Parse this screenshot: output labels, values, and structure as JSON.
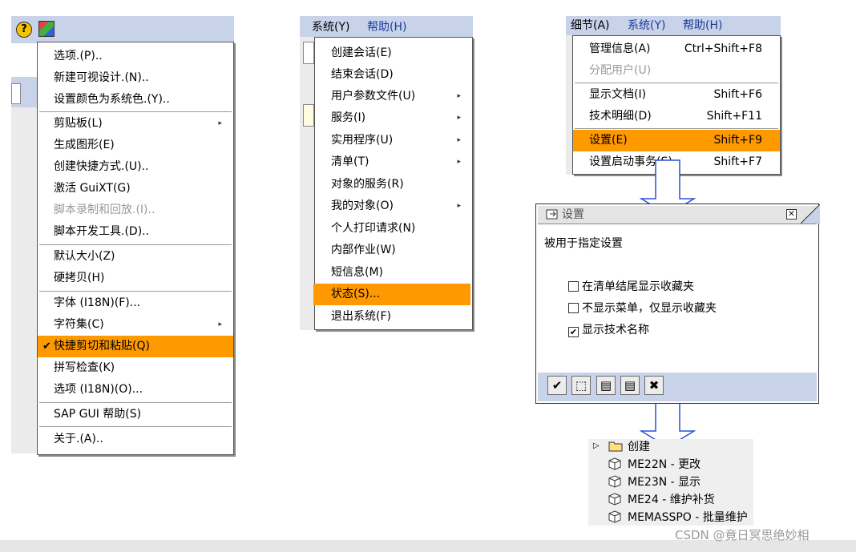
{
  "menu1": {
    "items": [
      {
        "label": "选项.(P).."
      },
      {
        "label": "新建可视设计.(N).."
      },
      {
        "label": "设置颜色为系统色.(Y).."
      },
      {
        "label": "剪贴板(L)"
      },
      {
        "label": "生成图形(E)"
      },
      {
        "label": "创建快捷方式.(U).."
      },
      {
        "label": "激活 GuiXT(G)"
      },
      {
        "label": "脚本录制和回放.(I).."
      },
      {
        "label": "脚本开发工具.(D).."
      },
      {
        "label": "默认大小(Z)"
      },
      {
        "label": "硬拷贝(H)"
      },
      {
        "label": "字体 (I18N)(F)..."
      },
      {
        "label": "字符集(C)"
      },
      {
        "label": "快捷剪切和粘贴(Q)"
      },
      {
        "label": "拼写检查(K)"
      },
      {
        "label": "选项 (I18N)(O)..."
      },
      {
        "label": "SAP GUI 帮助(S)"
      },
      {
        "label": "关于.(A).."
      }
    ]
  },
  "menu2": {
    "menubar": [
      "系统(Y)",
      "帮助(H)"
    ],
    "items": [
      {
        "label": "创建会话(E)"
      },
      {
        "label": "结束会话(D)"
      },
      {
        "label": "用户参数文件(U)"
      },
      {
        "label": "服务(I)"
      },
      {
        "label": "实用程序(U)"
      },
      {
        "label": "清单(T)"
      },
      {
        "label": "对象的服务(R)"
      },
      {
        "label": "我的对象(O)"
      },
      {
        "label": "个人打印请求(N)"
      },
      {
        "label": "内部作业(W)"
      },
      {
        "label": "短信息(M)"
      },
      {
        "label": "状态(S)..."
      },
      {
        "label": "退出系统(F)"
      }
    ]
  },
  "menu3": {
    "menubar": [
      "细节(A)",
      "系统(Y)",
      "帮助(H)"
    ],
    "items": [
      {
        "label": "管理信息(A)",
        "shortcut": "Ctrl+Shift+F8"
      },
      {
        "label": "分配用户(U)",
        "shortcut": ""
      },
      {
        "label": "显示文档(I)",
        "shortcut": "Shift+F6"
      },
      {
        "label": "技术明细(D)",
        "shortcut": "Shift+F11"
      },
      {
        "label": "设置(E)",
        "shortcut": "Shift+F9"
      },
      {
        "label": "设置启动事务(S)",
        "shortcut": "Shift+F7"
      }
    ]
  },
  "dialog": {
    "title": "设置",
    "subtitle": "被用于指定设置",
    "options": [
      {
        "label": "在清单结尾显示收藏夹",
        "checked": false
      },
      {
        "label": "不显示菜单，仅显示收藏夹",
        "checked": false
      },
      {
        "label": "显示技术名称",
        "checked": true
      }
    ],
    "buttons": [
      "confirm",
      "select",
      "save-a",
      "save-b",
      "cancel"
    ]
  },
  "tree": {
    "folder": "创建",
    "items": [
      "ME22N - 更改",
      "ME23N - 显示",
      "ME24 - 维护补货",
      "MEMASSPO - 批量维护"
    ]
  },
  "watermark": "CSDN @竟日冥思绝妙相",
  "colors": {
    "highlight": "#ff9900",
    "bar": "#c8d2e8",
    "arrow": "#2d4fd6"
  }
}
